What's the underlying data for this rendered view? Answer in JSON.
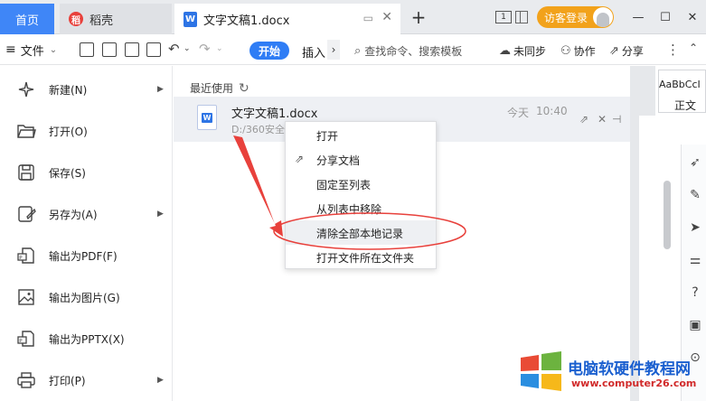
{
  "titlebar": {
    "home_tab": "首页",
    "doke_tab": "稻壳",
    "doc_tab": "文字文稿1.docx",
    "add_tab": "+",
    "badge": "1",
    "login": "访客登录"
  },
  "toolbar": {
    "file": "文件",
    "start": "开始",
    "insert": "插入",
    "search": "查找命令、搜索模板",
    "sync": "未同步",
    "collab": "协作",
    "share": "分享"
  },
  "left_menu": {
    "items": [
      {
        "label": "新建(N)",
        "arrow": true
      },
      {
        "label": "打开(O)",
        "arrow": false
      },
      {
        "label": "保存(S)",
        "arrow": false
      },
      {
        "label": "另存为(A)",
        "arrow": true
      },
      {
        "label": "输出为PDF(F)",
        "arrow": false
      },
      {
        "label": "输出为图片(G)",
        "arrow": false
      },
      {
        "label": "输出为PPTX(X)",
        "arrow": false
      },
      {
        "label": "打印(P)",
        "arrow": true
      }
    ]
  },
  "recent": {
    "title": "最近使用",
    "file": {
      "name": "文字文稿1.docx",
      "path": "D:/360安全",
      "day": "今天",
      "time": "10:40"
    }
  },
  "context_menu": {
    "items": [
      "打开",
      "分享文档",
      "固定至列表",
      "从列表中移除",
      "清除全部本地记录",
      "打开文件所在文件夹"
    ]
  },
  "style_panel": {
    "sample": "AaBbCcI",
    "name": "正文"
  },
  "watermark": {
    "title": "电脑软硬件教程网",
    "url": "www.computer26.com"
  },
  "colors": {
    "accent": "#2f7df5",
    "home_tab": "#3f86f7",
    "login": "#f2a21b",
    "annotation": "#e8413c"
  }
}
